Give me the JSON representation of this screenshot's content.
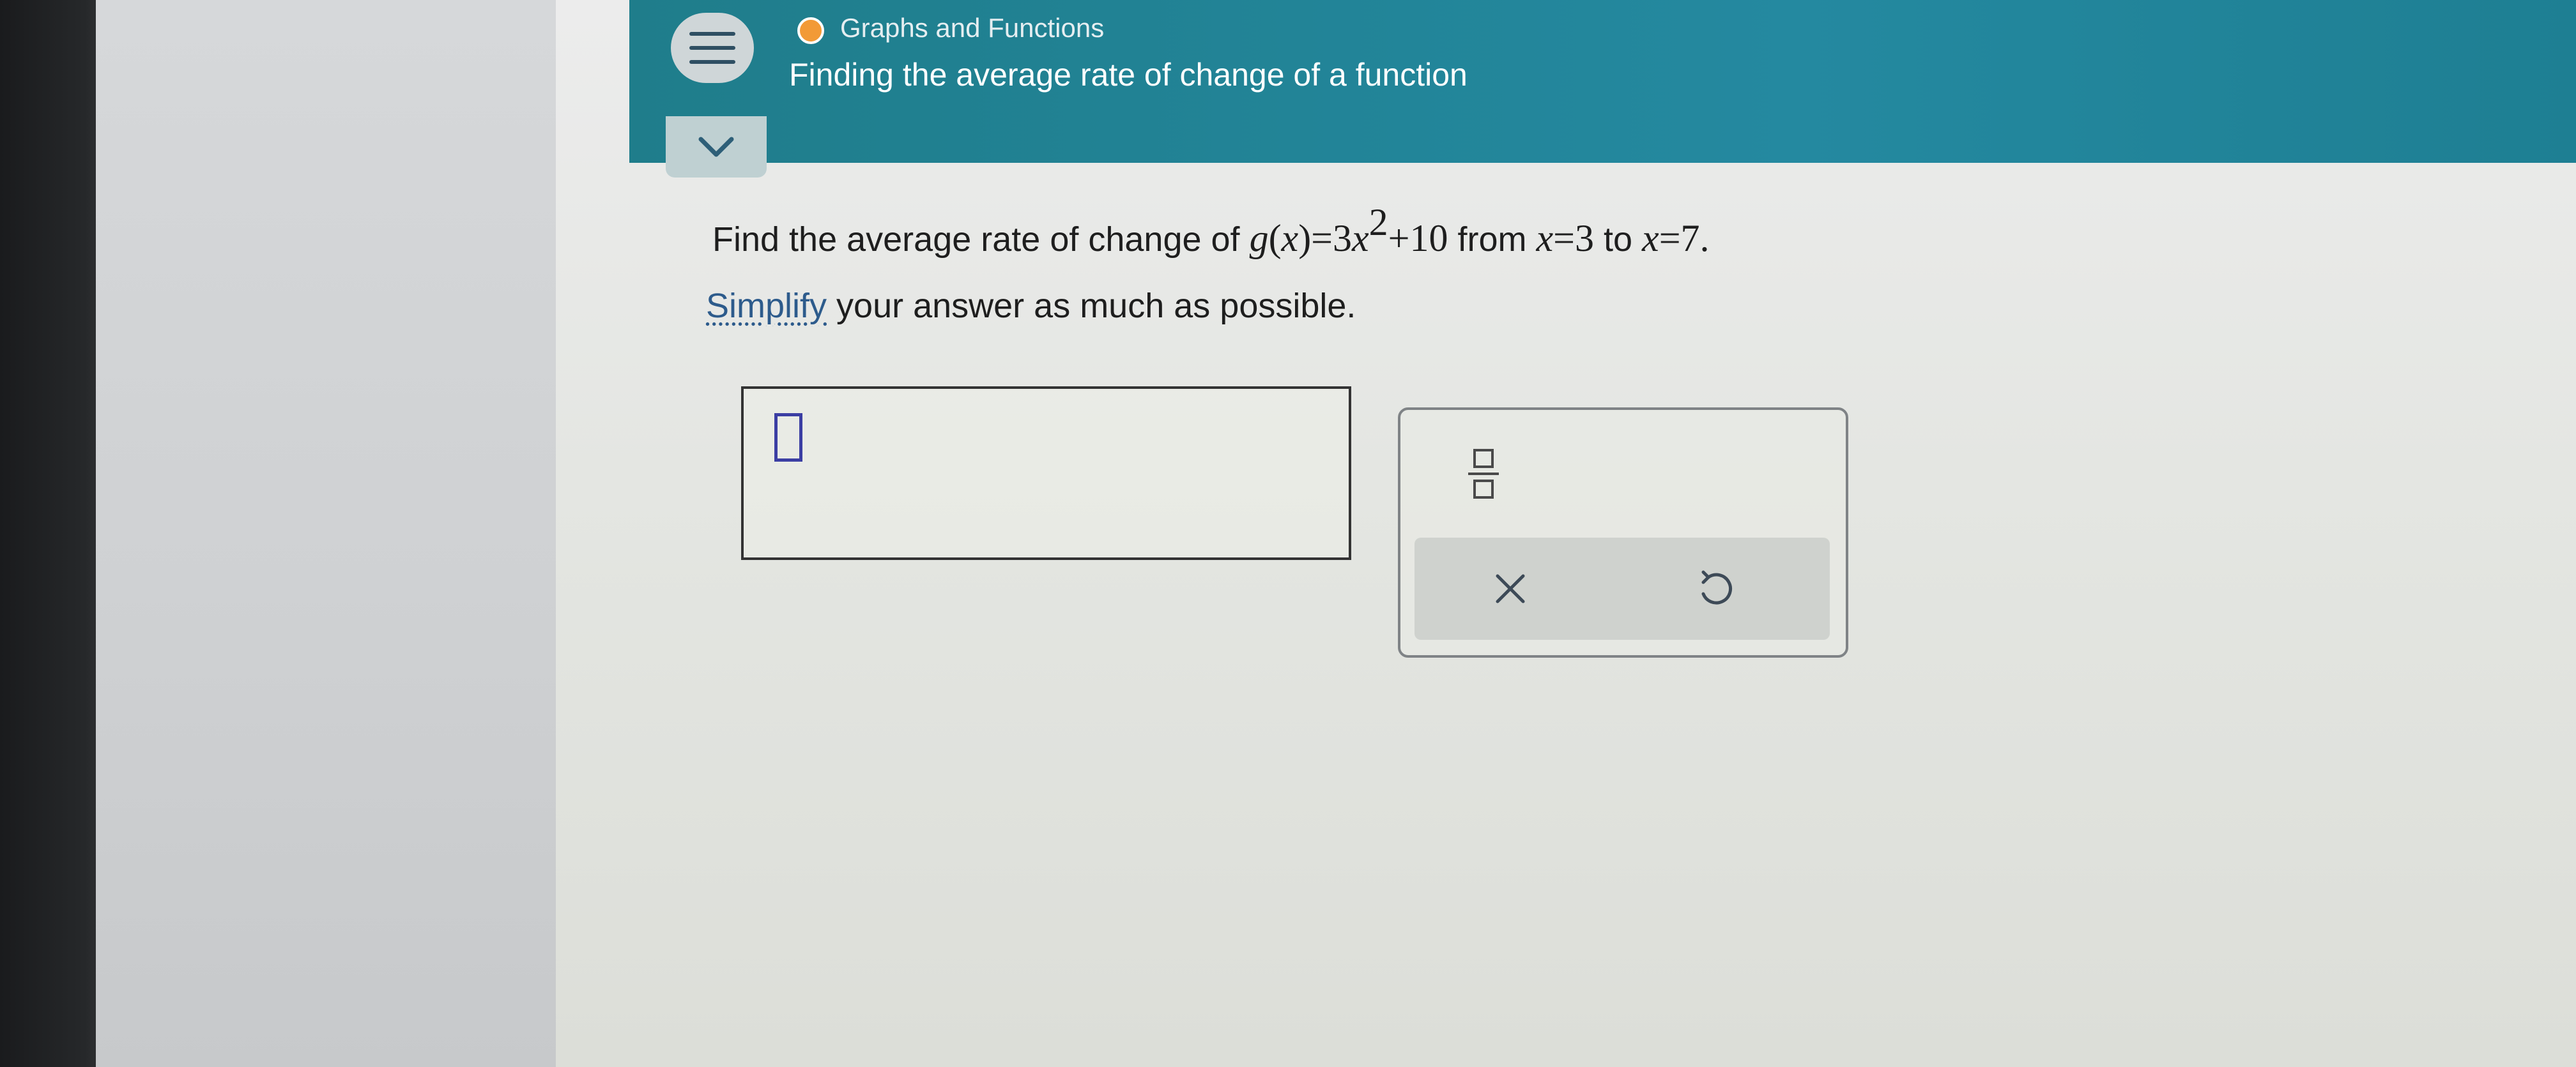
{
  "header": {
    "topic_label": "Graphs and Functions",
    "lesson_title": "Finding the average rate of change of a function"
  },
  "question": {
    "prefix": "Find the average rate of change of ",
    "func_name": "g",
    "func_arg": "x",
    "equals": "=",
    "coefficient": "3",
    "variable": "x",
    "exponent": "2",
    "constant": "+10",
    "from_text": " from ",
    "start_var": "x",
    "start_eq": "=3",
    "to_text": " to ",
    "end_var": "x",
    "end_eq": "=7."
  },
  "instruction": {
    "link_text": "Simplify",
    "rest": " your answer as much as possible."
  },
  "colors": {
    "header": "#2489a0",
    "topic_dot": "#f29a36",
    "link": "#2d5b8c",
    "cursor": "#3b3ea3"
  },
  "icons": {
    "menu": "hamburger-icon",
    "collapse": "chevron-down-icon",
    "fraction": "fraction-icon",
    "clear": "close-icon",
    "undo": "undo-icon"
  }
}
